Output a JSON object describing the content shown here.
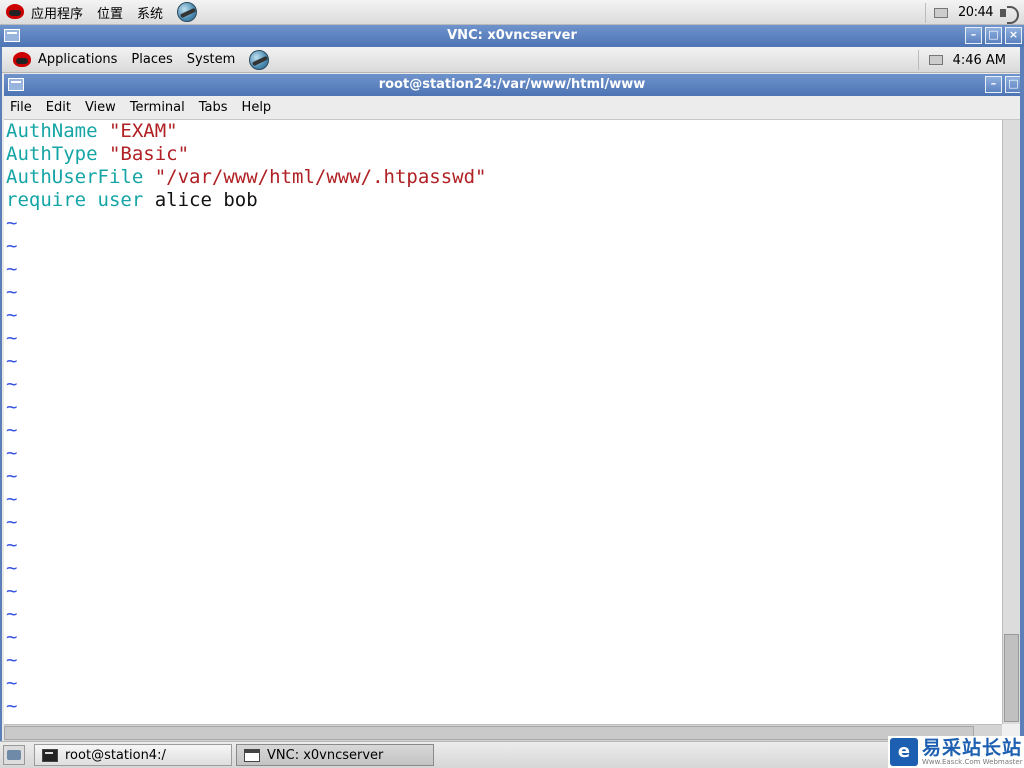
{
  "outer_panel": {
    "menus": [
      "应用程序",
      "位置",
      "系统"
    ],
    "clock": "20:44"
  },
  "vnc_window": {
    "title": "VNC: x0vncserver",
    "buttons": [
      "–",
      "□",
      "×"
    ]
  },
  "inner_panel": {
    "menus": [
      "Applications",
      "Places",
      "System"
    ],
    "clock": "4:46 AM"
  },
  "terminal": {
    "title": "root@station24:/var/www/html/www",
    "buttons": [
      "–",
      "□"
    ],
    "menu": [
      "File",
      "Edit",
      "View",
      "Terminal",
      "Tabs",
      "Help"
    ],
    "lines": [
      [
        {
          "t": "AuthName",
          "c": "kw"
        },
        {
          "t": " ",
          "c": "txt"
        },
        {
          "t": "\"EXAM\"",
          "c": "str"
        }
      ],
      [
        {
          "t": "AuthType",
          "c": "kw"
        },
        {
          "t": " ",
          "c": "txt"
        },
        {
          "t": "\"Basic\"",
          "c": "str"
        }
      ],
      [
        {
          "t": "AuthUserFile",
          "c": "kw"
        },
        {
          "t": " ",
          "c": "txt"
        },
        {
          "t": "\"/var/www/html/www/.htpasswd\"",
          "c": "str"
        }
      ],
      [
        {
          "t": "require",
          "c": "kw"
        },
        {
          "t": " ",
          "c": "txt"
        },
        {
          "t": "user",
          "c": "kw"
        },
        {
          "t": " alice bob",
          "c": "txt"
        }
      ]
    ],
    "empty_line_marker": "~",
    "empty_line_count": 22
  },
  "taskbar": {
    "tasks": [
      "root@station4:/",
      "VNC: x0vncserver"
    ]
  },
  "watermark": {
    "logo": "e",
    "text": "易采站长站",
    "subtext": "Www.Easck.Com Webmaster"
  },
  "colors": {
    "keyword": "#16a5a6",
    "string": "#b02024",
    "tilde": "#3552e0",
    "titlebar": "#5a7fb9"
  }
}
